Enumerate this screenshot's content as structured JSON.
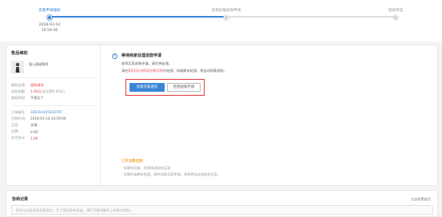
{
  "stepper": {
    "steps": [
      {
        "label": "买家申请维权",
        "state": "active",
        "date": "2018-03-14",
        "time": "10:59:30"
      },
      {
        "label": "商家处理退款申请",
        "state": "pending"
      },
      {
        "label": "退款完成",
        "state": "pending"
      }
    ]
  },
  "left": {
    "title": "售后维权",
    "product_name": "导入测试001",
    "info": [
      {
        "k": "维权处理:",
        "v": "退款退货",
        "style": "red"
      },
      {
        "k": "退款金额:",
        "v": "1.00元",
        "extra": "(含运费0.00元)",
        "style": "red-amt"
      },
      {
        "k": "维权原因:",
        "v": "不想买了",
        "style": ""
      }
    ],
    "order": [
      {
        "k": "订单编号:",
        "v": "180314105318797",
        "style": "link"
      },
      {
        "k": "付款时间:",
        "v": "2018-03-14 10:59:00",
        "style": ""
      },
      {
        "k": "买家:",
        "v": "未填",
        "style": ""
      },
      {
        "k": "运费:",
        "v": "0.00",
        "style": ""
      },
      {
        "k": "实付合计:",
        "v": "1.00",
        "style": "red"
      }
    ]
  },
  "right": {
    "icon": "i",
    "title": "等待商家处理退款申请",
    "line1": "收到买家退款申请，请尽快处理。",
    "line2_pre": "请在",
    "line2_countdown": "6天23小时55分钟11秒",
    "line2_post": "内处理，如逾期未处理，将自动同意退款。",
    "btn_agree": "同意买家退货",
    "btn_disagree": "拒绝退款申请",
    "reminder_title": "订单温馨提醒:",
    "reminders": [
      "· 如果你同意，将直接退款给买家",
      "· 如果你逾期未处理，视作同意买家申请，系统将自动退款给买家。"
    ]
  },
  "records": {
    "title": "协商记录",
    "link": "点击收费留言",
    "placeholder": "你可以在这里给买家留言，为了保证你的权益，请尽可能详细的上传留言资料。"
  },
  "colors": {
    "accent": "#3a86d6",
    "alert": "#e4393c",
    "warning": "#f08a00"
  }
}
